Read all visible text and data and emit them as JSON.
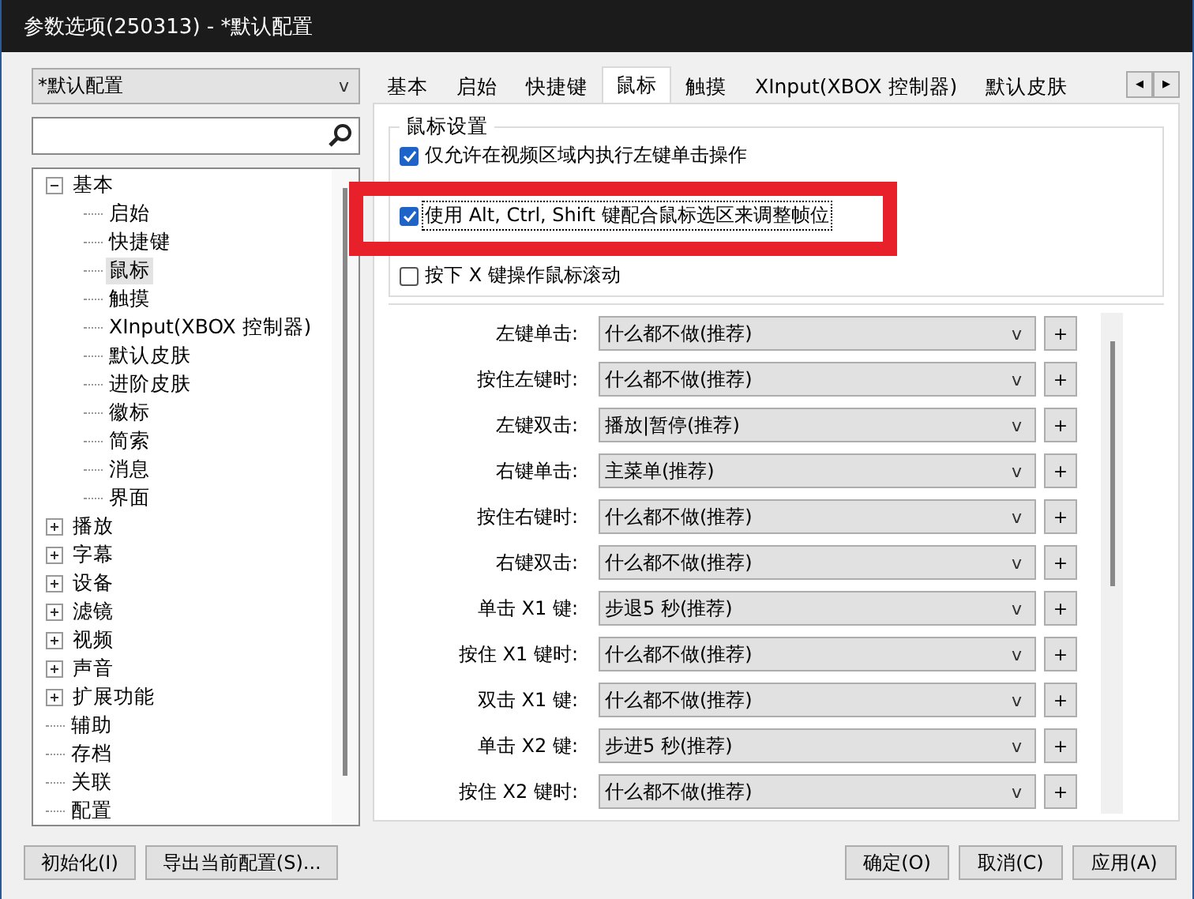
{
  "window": {
    "title": "参数选项(250313) - *默认配置"
  },
  "profile": {
    "value": "*默认配置",
    "caret": "v"
  },
  "tree": [
    {
      "label": "基本",
      "expanded": true,
      "selected": false,
      "children": [
        {
          "label": "启始",
          "selected": false
        },
        {
          "label": "快捷键",
          "selected": false
        },
        {
          "label": "鼠标",
          "selected": true
        },
        {
          "label": "触摸",
          "selected": false
        },
        {
          "label": "XInput(XBOX 控制器)",
          "selected": false
        },
        {
          "label": "默认皮肤",
          "selected": false
        },
        {
          "label": "进阶皮肤",
          "selected": false
        },
        {
          "label": "徽标",
          "selected": false
        },
        {
          "label": "简索",
          "selected": false
        },
        {
          "label": "消息",
          "selected": false
        },
        {
          "label": "界面",
          "selected": false
        }
      ]
    },
    {
      "label": "播放",
      "expanded": false,
      "selected": false
    },
    {
      "label": "字幕",
      "expanded": false,
      "selected": false
    },
    {
      "label": "设备",
      "expanded": false,
      "selected": false
    },
    {
      "label": "滤镜",
      "expanded": false,
      "selected": false
    },
    {
      "label": "视频",
      "expanded": false,
      "selected": false
    },
    {
      "label": "声音",
      "expanded": false,
      "selected": false
    },
    {
      "label": "扩展功能",
      "expanded": false,
      "selected": false
    },
    {
      "label": "辅助",
      "selected": false
    },
    {
      "label": "存档",
      "selected": false
    },
    {
      "label": "关联",
      "selected": false
    },
    {
      "label": "配置",
      "selected": false
    }
  ],
  "tabs": [
    {
      "label": "基本",
      "selected": false
    },
    {
      "label": "启始",
      "selected": false
    },
    {
      "label": "快捷键",
      "selected": false
    },
    {
      "label": "鼠标",
      "selected": true
    },
    {
      "label": "触摸",
      "selected": false
    },
    {
      "label": "XInput(XBOX 控制器)",
      "selected": false
    },
    {
      "label": "默认皮肤",
      "selected": false
    }
  ],
  "mouse_settings": {
    "title": "鼠标设置",
    "options": [
      {
        "label": "仅允许在视频区域内执行左键单击操作",
        "checked": true,
        "highlighted": false
      },
      {
        "label": "使用 Alt, Ctrl, Shift 键配合鼠标选区来调整帧位",
        "checked": true,
        "highlighted": true
      },
      {
        "label": "按下 X 键操作鼠标滚动",
        "checked": false,
        "highlighted": false
      }
    ]
  },
  "actions": [
    {
      "label": "左键单击:",
      "value": "什么都不做(推荐)",
      "caret": "v",
      "add": "+"
    },
    {
      "label": "按住左键时:",
      "value": "什么都不做(推荐)",
      "caret": "v",
      "add": "+"
    },
    {
      "label": "左键双击:",
      "value": "播放|暂停(推荐)",
      "caret": "v",
      "add": "+"
    },
    {
      "label": "右键单击:",
      "value": "主菜单(推荐)",
      "caret": "v",
      "add": "+"
    },
    {
      "label": "按住右键时:",
      "value": "什么都不做(推荐)",
      "caret": "v",
      "add": "+"
    },
    {
      "label": "右键双击:",
      "value": "什么都不做(推荐)",
      "caret": "v",
      "add": "+"
    },
    {
      "label": "单击 X1 键:",
      "value": "步退5 秒(推荐)",
      "caret": "v",
      "add": "+"
    },
    {
      "label": "按住 X1 键时:",
      "value": "什么都不做(推荐)",
      "caret": "v",
      "add": "+"
    },
    {
      "label": "双击 X1 键:",
      "value": "什么都不做(推荐)",
      "caret": "v",
      "add": "+"
    },
    {
      "label": "单击 X2 键:",
      "value": "步进5 秒(推荐)",
      "caret": "v",
      "add": "+"
    },
    {
      "label": "按住 X2 键时:",
      "value": "什么都不做(推荐)",
      "caret": "v",
      "add": "+"
    }
  ],
  "tab_scroll": {
    "left": "◂",
    "right": "▸"
  },
  "left_buttons": [
    "初始化(I)",
    "导出当前配置(S)..."
  ],
  "right_buttons": [
    "确定(O)",
    "取消(C)",
    "应用(A)"
  ]
}
